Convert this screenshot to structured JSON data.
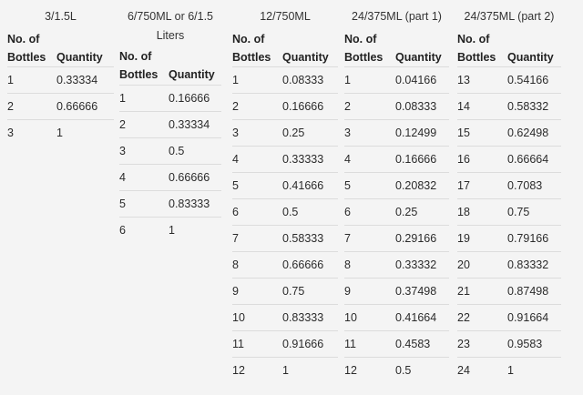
{
  "tables": [
    {
      "caption": "3/1.5L",
      "header": [
        "No. of\nBottles",
        "Quantity"
      ],
      "rows": [
        [
          "1",
          "0.33334"
        ],
        [
          "2",
          "0.66666"
        ],
        [
          "3",
          "1"
        ]
      ]
    },
    {
      "caption": "6/750ML or 6/1.5\nLiters",
      "header": [
        "No. of\nBottles",
        "Quantity"
      ],
      "rows": [
        [
          "1",
          "0.16666"
        ],
        [
          "2",
          "0.33334"
        ],
        [
          "3",
          "0.5"
        ],
        [
          "4",
          "0.66666"
        ],
        [
          "5",
          "0.83333"
        ],
        [
          "6",
          "1"
        ]
      ]
    },
    {
      "caption": "12/750ML",
      "header": [
        "No. of\nBottles",
        "Quantity"
      ],
      "rows": [
        [
          "1",
          "0.08333"
        ],
        [
          "2",
          "0.16666"
        ],
        [
          "3",
          "0.25"
        ],
        [
          "4",
          "0.33333"
        ],
        [
          "5",
          "0.41666"
        ],
        [
          "6",
          "0.5"
        ],
        [
          "7",
          "0.58333"
        ],
        [
          "8",
          "0.66666"
        ],
        [
          "9",
          "0.75"
        ],
        [
          "10",
          "0.83333"
        ],
        [
          "11",
          "0.91666"
        ],
        [
          "12",
          "1"
        ]
      ]
    },
    {
      "caption": "24/375ML (part 1)",
      "header": [
        "No. of\nBottles",
        "Quantity"
      ],
      "rows": [
        [
          "1",
          "0.04166"
        ],
        [
          "2",
          "0.08333"
        ],
        [
          "3",
          "0.12499"
        ],
        [
          "4",
          "0.16666"
        ],
        [
          "5",
          "0.20832"
        ],
        [
          "6",
          "0.25"
        ],
        [
          "7",
          "0.29166"
        ],
        [
          "8",
          "0.33332"
        ],
        [
          "9",
          "0.37498"
        ],
        [
          "10",
          "0.41664"
        ],
        [
          "11",
          "0.4583"
        ],
        [
          "12",
          "0.5"
        ]
      ]
    },
    {
      "caption": "24/375ML (part 2)",
      "header": [
        "No. of\nBottles",
        "Quantity"
      ],
      "rows": [
        [
          "13",
          "0.54166"
        ],
        [
          "14",
          "0.58332"
        ],
        [
          "15",
          "0.62498"
        ],
        [
          "16",
          "0.66664"
        ],
        [
          "17",
          "0.7083"
        ],
        [
          "18",
          "0.75"
        ],
        [
          "19",
          "0.79166"
        ],
        [
          "20",
          "0.83332"
        ],
        [
          "21",
          "0.87498"
        ],
        [
          "22",
          "0.91664"
        ],
        [
          "23",
          "0.9583"
        ],
        [
          "24",
          "1"
        ]
      ]
    }
  ]
}
